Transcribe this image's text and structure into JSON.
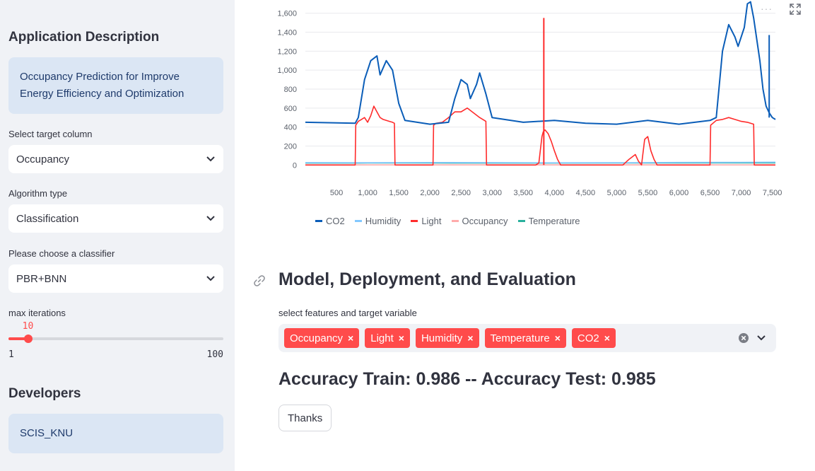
{
  "sidebar": {
    "app_desc_heading": "Application Description",
    "app_desc_text": "Occupancy Prediction for Improve Energy Efficiency and Optimization",
    "target_label": "Select target column",
    "target_value": "Occupancy",
    "algo_label": "Algorithm type",
    "algo_value": "Classification",
    "classifier_label": "Please choose a classifier",
    "classifier_value": "PBR+BNN",
    "iter_label": "max iterations",
    "iter_value": "10",
    "iter_min": "1",
    "iter_max": "100",
    "iter_fraction": 0.0909,
    "dev_heading": "Developers",
    "dev_text": "SCIS_KNU"
  },
  "main": {
    "more_label": "···",
    "section_title": "Model, Deployment, and Evaluation",
    "multiselect_label": "select features and target variable",
    "tags": [
      {
        "label": "Occupancy",
        "x": "×"
      },
      {
        "label": "Light",
        "x": "×"
      },
      {
        "label": "Humidity",
        "x": "×"
      },
      {
        "label": "Temperature",
        "x": "×"
      },
      {
        "label": "CO2",
        "x": "×"
      }
    ],
    "accuracy_text": "Accuracy Train: 0.986 -- Accuracy Test: 0.985",
    "thanks_label": "Thanks"
  },
  "chart_data": {
    "type": "line",
    "title": "",
    "xlabel": "",
    "ylabel": "",
    "xlim": [
      0,
      7550
    ],
    "ylim": [
      -50,
      1650
    ],
    "grid": true,
    "legend_position": "bottom",
    "y_ticks": [
      "0",
      "200",
      "400",
      "600",
      "800",
      "1,000",
      "1,200",
      "1,400",
      "1,600"
    ],
    "x_ticks": [
      "500",
      "1,000",
      "1,500",
      "2,000",
      "2,500",
      "3,000",
      "3,500",
      "4,000",
      "4,500",
      "5,000",
      "5,500",
      "6,000",
      "6,500",
      "7,000",
      "7,500"
    ],
    "legend": [
      "CO2",
      "Humidity",
      "Light",
      "Occupancy",
      "Temperature"
    ],
    "colors": {
      "CO2": "#0a5db8",
      "Humidity": "#83c9ff",
      "Light": "#ff2b2b",
      "Occupancy": "#ffabab",
      "Temperature": "#29b09d"
    },
    "series": [
      {
        "name": "CO2",
        "x": [
          0,
          800,
          850,
          950,
          1050,
          1150,
          1200,
          1300,
          1400,
          1500,
          1600,
          2000,
          2300,
          2400,
          2500,
          2600,
          2650,
          2750,
          2800,
          2900,
          3000,
          3500,
          4000,
          4500,
          5000,
          5500,
          6000,
          6500,
          6600,
          6700,
          6800,
          6900,
          6950,
          7050,
          7100,
          7150,
          7200,
          7300,
          7350,
          7400,
          7450,
          7500,
          7550
        ],
        "y": [
          450,
          440,
          500,
          900,
          1100,
          1150,
          950,
          1100,
          1000,
          650,
          470,
          430,
          450,
          700,
          900,
          850,
          700,
          850,
          970,
          750,
          500,
          450,
          470,
          440,
          430,
          470,
          430,
          470,
          500,
          1200,
          1480,
          1350,
          1250,
          1450,
          1700,
          1720,
          1550,
          1100,
          800,
          620,
          550,
          500,
          480
        ]
      },
      {
        "name": "Light",
        "x": [
          0,
          800,
          810,
          850,
          900,
          950,
          1000,
          1050,
          1100,
          1150,
          1200,
          1250,
          1300,
          1350,
          1400,
          1430,
          1440,
          2050,
          2060,
          2100,
          2200,
          2300,
          2400,
          2500,
          2600,
          2700,
          2800,
          2900,
          2910,
          3700,
          3750,
          3800,
          3820,
          3850,
          3900,
          3950,
          4000,
          4050,
          4100,
          5100,
          5200,
          5300,
          5350,
          5400,
          5450,
          5500,
          5550,
          5600,
          5650,
          6500,
          6510,
          6600,
          6700,
          6800,
          6900,
          7000,
          7100,
          7150,
          7200,
          7210,
          7550
        ],
        "y": [
          0,
          0,
          420,
          460,
          480,
          500,
          450,
          520,
          620,
          560,
          500,
          480,
          470,
          460,
          450,
          440,
          0,
          0,
          420,
          440,
          450,
          500,
          560,
          560,
          600,
          550,
          500,
          460,
          0,
          0,
          20,
          300,
          350,
          370,
          330,
          250,
          150,
          60,
          0,
          0,
          60,
          110,
          40,
          0,
          270,
          300,
          150,
          60,
          0,
          0,
          420,
          470,
          480,
          500,
          480,
          460,
          450,
          440,
          430,
          0,
          0
        ]
      },
      {
        "name": "Humidity",
        "x": [
          0,
          1000,
          2000,
          3000,
          4000,
          5000,
          6000,
          7000,
          7550
        ],
        "y": [
          25,
          24,
          26,
          25,
          23,
          24,
          27,
          28,
          30
        ]
      },
      {
        "name": "Occupancy",
        "x": [
          0,
          7550
        ],
        "y": [
          1,
          1
        ]
      },
      {
        "name": "Temperature",
        "x": [
          0,
          1000,
          2000,
          3000,
          4000,
          5000,
          6000,
          7000,
          7550
        ],
        "y": [
          20,
          21,
          21,
          20,
          20,
          21,
          21,
          22,
          22
        ]
      }
    ]
  }
}
